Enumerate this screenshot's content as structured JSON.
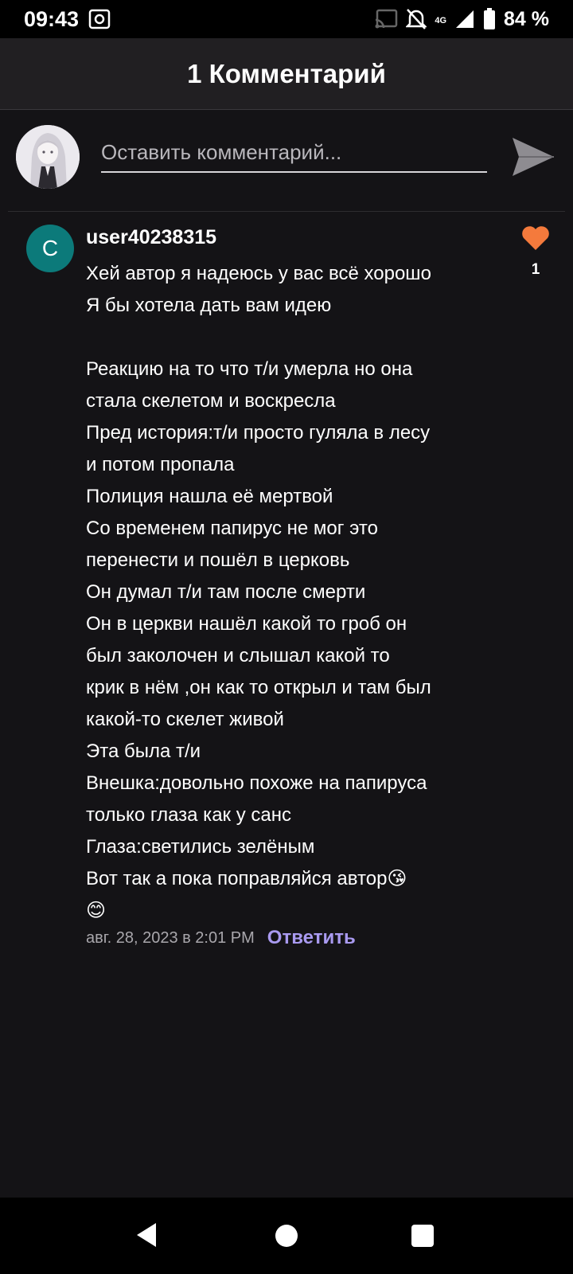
{
  "status_bar": {
    "time": "09:43",
    "network": "4G",
    "battery": "84 %"
  },
  "header": {
    "title": "1 Комментарий"
  },
  "composer": {
    "placeholder": "Оставить комментарий..."
  },
  "comment": {
    "avatar_letter": "C",
    "username": "user40238315",
    "lines": [
      "Хей автор я надеюсь у вас всё хорошо",
      "Я бы хотела дать вам идею",
      "",
      "Реакцию на то что т/и умерла но она",
      "стала скелетом и воскресла",
      "Пред история:т/и просто гуляла в лесу",
      "и потом пропала",
      "Полиция нашла её мертвой",
      "Со временем папирус не мог это",
      "перенести и пошёл в церковь",
      "Он думал т/и там после смерти",
      "Он в церкви нашёл какой то гроб он",
      "был заколочен и слышал какой то",
      "крик в нём ,он как то открыл и там был",
      "какой-то скелет живой",
      "Эта была т/и",
      "Внешка:довольно похоже на папируса",
      "только глаза как у санс",
      "Глаза:светились зелёным",
      "Вот так а пока поправляйся автор😘",
      "😊"
    ],
    "likes": "1",
    "date": "авг. 28, 2023 в 2:01 PM",
    "reply_label": "Ответить"
  },
  "colors": {
    "background": "#141316",
    "header_bg": "#211f22",
    "avatar_teal": "#0c7a7a",
    "like_orange": "#f47a3c",
    "reply_purple": "#a99af0"
  },
  "icons": {
    "status": [
      "gallery-icon",
      "cast-icon",
      "mute-icon",
      "signal-icon",
      "battery-icon"
    ],
    "composer": "send-icon",
    "like": "heart-icon",
    "nav": [
      "back-icon",
      "home-icon",
      "recents-icon"
    ]
  }
}
